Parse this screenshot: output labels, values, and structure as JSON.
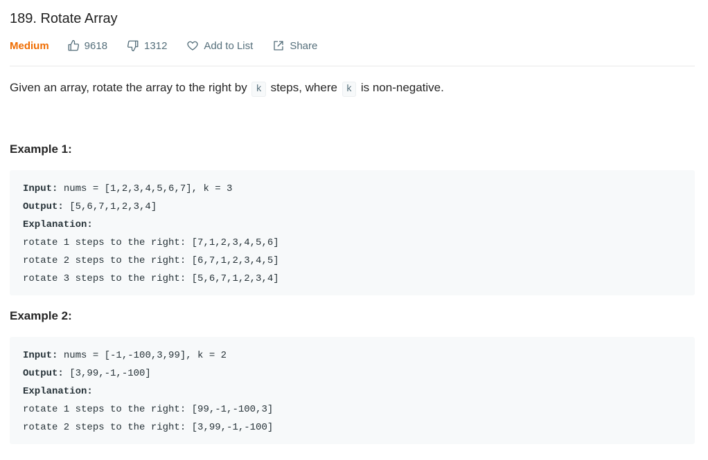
{
  "problem": {
    "title": "189. Rotate Array",
    "difficulty": "Medium",
    "likes": "9618",
    "dislikes": "1312",
    "add_to_list": "Add to List",
    "share": "Share",
    "description": {
      "part1": "Given an array, rotate the array to the right by",
      "code1": "k",
      "part2": "steps, where",
      "code2": "k",
      "part3": "is non-negative."
    }
  },
  "examples": [
    {
      "title": "Example 1:",
      "input_label": "Input:",
      "input_value": " nums = [1,2,3,4,5,6,7], k = 3",
      "output_label": "Output:",
      "output_value": " [5,6,7,1,2,3,4]",
      "explanation_label": "Explanation:",
      "lines": [
        "rotate 1 steps to the right: [7,1,2,3,4,5,6]",
        "rotate 2 steps to the right: [6,7,1,2,3,4,5]",
        "rotate 3 steps to the right: [5,6,7,1,2,3,4]"
      ]
    },
    {
      "title": "Example 2:",
      "input_label": "Input:",
      "input_value": " nums = [-1,-100,3,99], k = 2",
      "output_label": "Output:",
      "output_value": " [3,99,-1,-100]",
      "explanation_label": "Explanation:",
      "lines": [
        "rotate 1 steps to the right: [99,-1,-100,3]",
        "rotate 2 steps to the right: [3,99,-1,-100]"
      ]
    }
  ],
  "icons": {
    "like": "thumbs-up-icon",
    "dislike": "thumbs-down-icon",
    "add_to_list": "heart-icon",
    "share": "share-icon"
  },
  "colors": {
    "difficulty_medium": "#ef6c00",
    "meta_text": "#546e7a",
    "code_bg": "#f7f9fa"
  }
}
